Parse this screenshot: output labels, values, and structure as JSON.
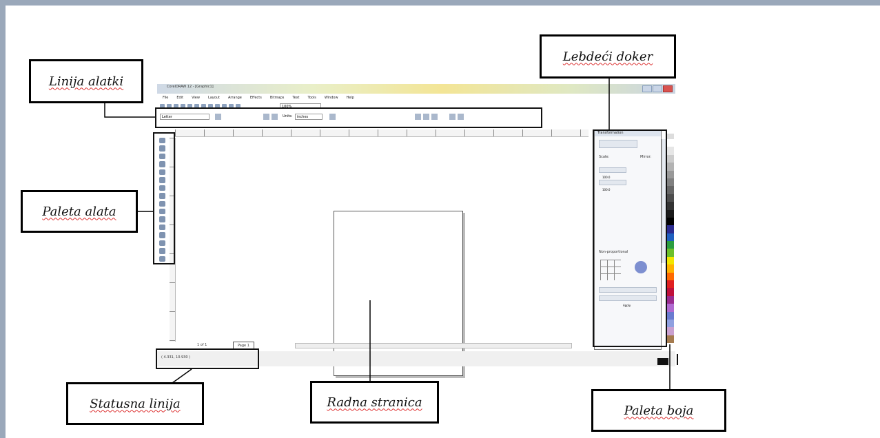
{
  "labels": {
    "toolbar": "Linija alatki",
    "floating_docker": "Lebdeći doker",
    "toolbox": "Paleta alata",
    "status_bar": "Statusna linija",
    "work_page": "Radna stranica",
    "color_palette": "Paleta boja"
  },
  "app": {
    "title": "CorelDRAW 12 - [Graphic1]",
    "menu": [
      "File",
      "Edit",
      "View",
      "Layout",
      "Arrange",
      "Effects",
      "Bitmaps",
      "Text",
      "Tools",
      "Window",
      "Help"
    ],
    "zoom": "100%",
    "paper_size": "Letter",
    "units_label": "Units:",
    "units_value": "inches",
    "page_count": "1 of 1",
    "page_tab": "Page 1",
    "status_coords": "( 4.331, 10.930 )",
    "docker": {
      "title": "Transformation",
      "scale_label": "Scale:",
      "mirror_label": "Mirror:",
      "scale_h": "100.0",
      "scale_v": "100.0",
      "non_proportional": "Non-proportional",
      "apply_duplicate": "Apply To Duplicate",
      "apply": "Apply"
    }
  },
  "colors": {
    "frame": "#9aa8ba",
    "annotation_border": "#000000",
    "palette": [
      "#ffffff",
      "#e6e6e6",
      "#cccccc",
      "#b3b3b3",
      "#999999",
      "#808080",
      "#666666",
      "#4d4d4d",
      "#333333",
      "#1a1a1a",
      "#000000",
      "#2b2b8f",
      "#1f5fbf",
      "#2a9d3f",
      "#6cbf2a",
      "#f2e600",
      "#ffb300",
      "#ff6a00",
      "#e02020",
      "#c0103a",
      "#9a2b8f",
      "#b06ad0",
      "#6a7bd0",
      "#8fa0e0",
      "#c9a0d0",
      "#a57b4f"
    ]
  }
}
